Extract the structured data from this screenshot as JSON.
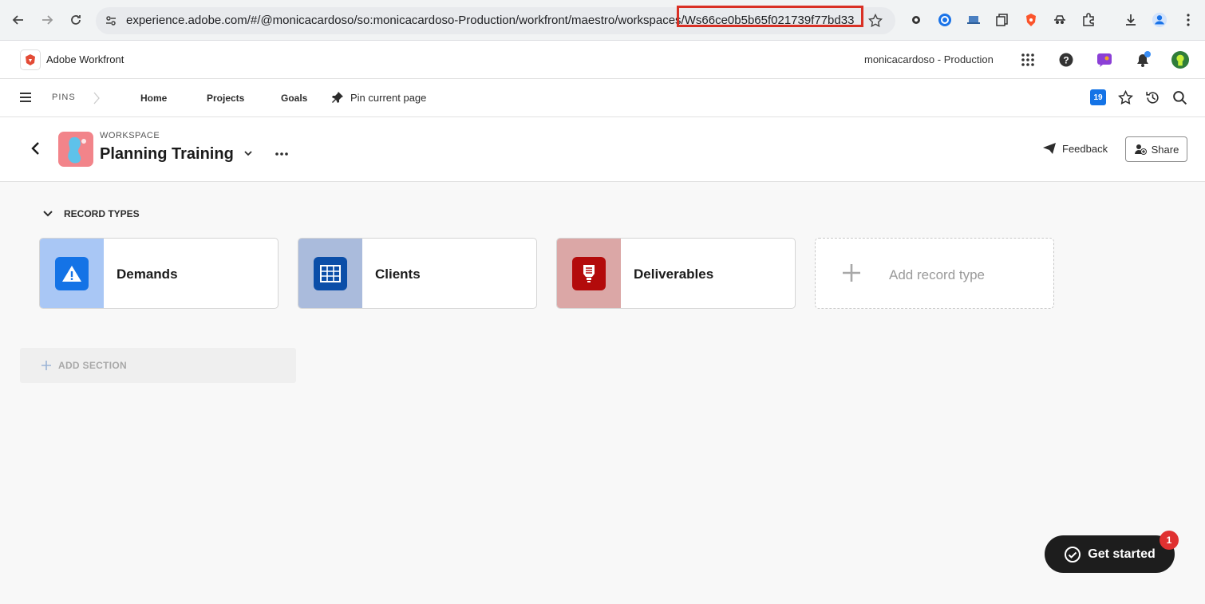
{
  "browser": {
    "url": "experience.adobe.com/#/@monicacardoso/so:monicacardoso-Production/workfront/maestro/workspaces/Ws66ce0b5b65f021739f77bd33"
  },
  "app_header": {
    "title": "Adobe Workfront",
    "org": "monicacardoso - Production"
  },
  "pins_bar": {
    "pins_label": "PINS",
    "links": [
      "Home",
      "Projects",
      "Goals"
    ],
    "pin_current": "Pin current page",
    "badge": "19"
  },
  "workspace": {
    "kicker": "WORKSPACE",
    "title": "Planning Training",
    "feedback_label": "Feedback",
    "share_label": "Share"
  },
  "record_types": {
    "section_title": "RECORD TYPES",
    "items": [
      {
        "name": "Demands",
        "icon": "warning-icon",
        "band_color": "#a9c7f5",
        "icon_color": "#1473e6"
      },
      {
        "name": "Clients",
        "icon": "table-grid-icon",
        "band_color": "#aabbdc",
        "icon_color": "#0b4ea8"
      },
      {
        "name": "Deliverables",
        "icon": "lightbulb-icon",
        "band_color": "#dba7a6",
        "icon_color": "#b30b0b"
      }
    ],
    "add_label": "Add record type"
  },
  "add_section_label": "ADD SECTION",
  "get_started": {
    "label": "Get started",
    "badge": "1"
  }
}
